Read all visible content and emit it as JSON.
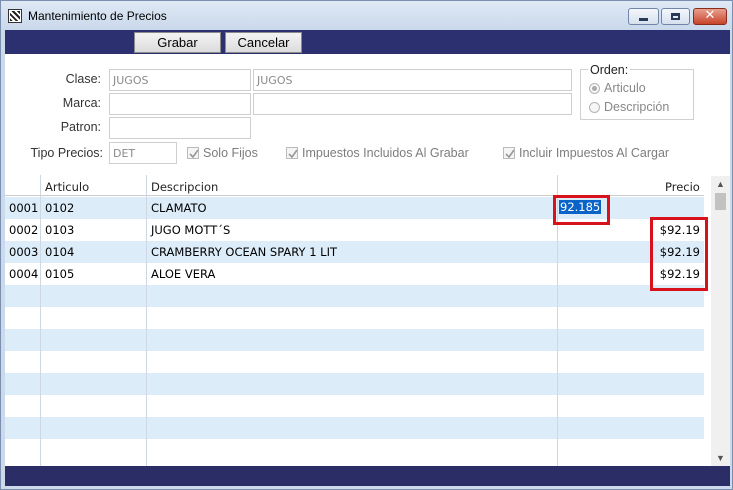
{
  "window": {
    "title": "Mantenimiento de Precios",
    "icon": "app-grid-icon"
  },
  "toolbar": {
    "grabar_label": "Grabar",
    "cancelar_label": "Cancelar"
  },
  "filters": {
    "clase_label": "Clase:",
    "clase_code": "JUGOS",
    "clase_desc": "JUGOS",
    "marca_label": "Marca:",
    "marca_code": "",
    "marca_desc": "",
    "patron_label": "Patron:",
    "patron_value": "",
    "tipo_precios_label": "Tipo Precios:",
    "tipo_precios_value": "DET"
  },
  "orden": {
    "title": "Orden:",
    "options": [
      {
        "label": "Articulo",
        "selected": true
      },
      {
        "label": "Descripción",
        "selected": false
      }
    ]
  },
  "options": {
    "solo_fijos": {
      "label": "Solo Fijos",
      "checked": true
    },
    "impuestos_incluidos": {
      "label": "Impuestos Incluidos Al Grabar",
      "checked": true
    },
    "incluir_impuestos": {
      "label": "Incluir Impuestos Al Cargar",
      "checked": true
    }
  },
  "grid": {
    "headers": {
      "num": "",
      "articulo": "Articulo",
      "descripcion": "Descripcion",
      "precio": "Precio"
    },
    "rows": [
      {
        "num": "0001",
        "articulo": "0102",
        "descripcion": "CLAMATO",
        "precio": "92.185",
        "editing": true
      },
      {
        "num": "0002",
        "articulo": "0103",
        "descripcion": "JUGO MOTT´S",
        "precio": "$92.19"
      },
      {
        "num": "0003",
        "articulo": "0104",
        "descripcion": "CRAMBERRY OCEAN SPARY 1 LIT",
        "precio": "$92.19"
      },
      {
        "num": "0004",
        "articulo": "0105",
        "descripcion": "ALOE VERA",
        "precio": "$92.19"
      }
    ],
    "empty_rows": 8
  },
  "colors": {
    "highlight": "#d8121c",
    "selection": "#0a64c8",
    "alt_row": "#dcecf8",
    "toolbar": "#2d3070"
  }
}
